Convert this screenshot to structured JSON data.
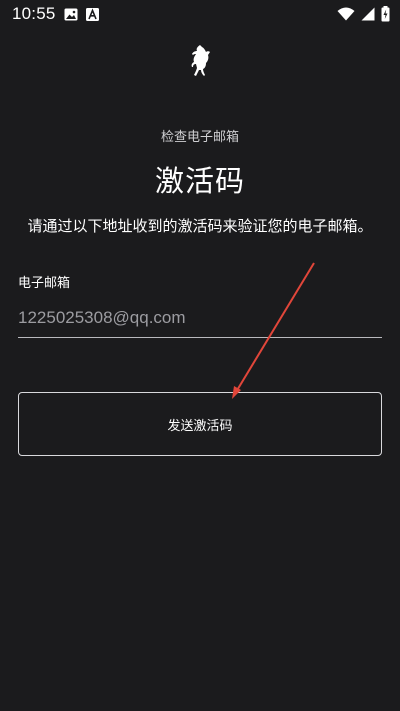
{
  "status_bar": {
    "time": "10:55",
    "icons": [
      "image-icon",
      "app-a-icon",
      "wifi-icon",
      "signal-icon",
      "battery-charging-icon"
    ]
  },
  "logo": {
    "icon": "prancing-horse-logo"
  },
  "page": {
    "subtitle": "检查电子邮箱",
    "title": "激活码",
    "description": "请通过以下地址收到的激活码来验证您的电子邮箱。"
  },
  "form": {
    "email_label": "电子邮箱",
    "email_value": "1225025308@qq.com"
  },
  "actions": {
    "send_label": "发送激活码"
  },
  "colors": {
    "background": "#1b1b1d",
    "text": "#ffffff",
    "muted_text": "#9c9ca1",
    "annotation_arrow": "#e1463a"
  }
}
